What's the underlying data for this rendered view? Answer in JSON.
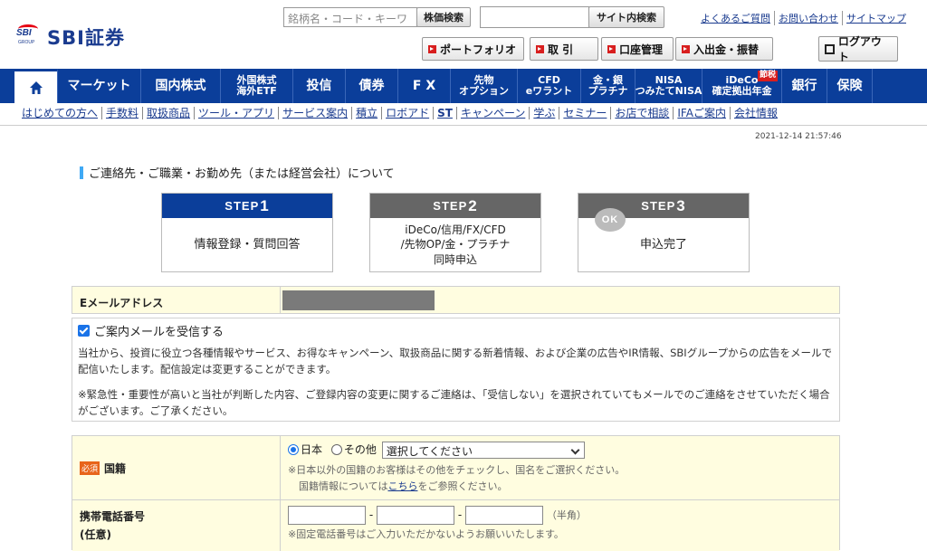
{
  "header": {
    "logo_mark": "SBI",
    "logo_group": "GROUP",
    "logo_text": "SBI証券",
    "search_placeholder": "銘柄名・コード・キーワ",
    "search_button": "株価検索",
    "site_search_button": "サイト内検索",
    "top_links": [
      "よくあるご質問",
      "お問い合わせ",
      "サイトマップ"
    ],
    "user_buttons": [
      "ポートフォリオ",
      "取 引",
      "口座管理",
      "入出金・振替"
    ],
    "logout": "ログアウト"
  },
  "nav": {
    "items": [
      {
        "label": "マーケット"
      },
      {
        "label": "国内株式"
      },
      {
        "label": "外国株式\n海外ETF"
      },
      {
        "label": "投信"
      },
      {
        "label": "債券"
      },
      {
        "label": "F X"
      },
      {
        "label": "先物\nオプション"
      },
      {
        "label": "CFD\neワラント"
      },
      {
        "label": "金・銀\nプラチナ"
      },
      {
        "label": "NISA\nつみたてNISA"
      },
      {
        "label": "iDeCo\n確定拠出年金",
        "badge": "節税"
      },
      {
        "label": "銀行"
      },
      {
        "label": "保険"
      }
    ],
    "sub_items": [
      "はじめての方へ",
      "手数料",
      "取扱商品",
      "ツール・アプリ",
      "サービス案内",
      "積立",
      "ロボアド",
      "ST",
      "キャンペーン",
      "学ぶ",
      "セミナー",
      "お店で相談",
      "IFAご案内",
      "会社情報"
    ]
  },
  "timestamp": "2021-12-14 21:57:46",
  "section_title": "ご連絡先・ご職業・お勤め先（または経営会社）について",
  "steps": [
    {
      "label": "STEP",
      "num": "1",
      "body": "情報登録・質問回答",
      "color": "#0b3e9a"
    },
    {
      "label": "STEP",
      "num": "2",
      "body": "iDeCo/信用/FX/CFD\n/先物OP/金・プラチナ\n同時申込",
      "color": "#666666"
    },
    {
      "label": "STEP",
      "num": "3",
      "body": "申込完了",
      "color": "#666666",
      "ok": "OK"
    }
  ],
  "email": {
    "label": "Eメールアドレス"
  },
  "mail_option": {
    "checkbox_label": "ご案内メールを受信する",
    "checked": true,
    "paragraph1": "当社から、投資に役立つ各種情報やサービス、お得なキャンペーン、取扱商品に関する新着情報、および企業の広告やIR情報、SBIグループからの広告をメールで配信いたします。配信設定は変更することができます。",
    "paragraph2": "※緊急性・重要性が高いと当社が判断した内容、ご登録内容の変更に関するご連絡は、「受信しない」を選択されていてもメールでのご連絡をさせていただく場合がございます。ご了承ください。"
  },
  "nationality": {
    "required_badge": "必須",
    "label": "国籍",
    "option_japan": "日本",
    "option_other": "その他",
    "selected": "日本",
    "select_value": "選択してください",
    "note1": "※日本以外の国籍のお客様はその他をチェックし、国名をご選択ください。",
    "note2_prefix": "国籍情報については",
    "note2_link": "こちら",
    "note2_suffix": "をご参照ください。"
  },
  "mobile": {
    "label": "携帯電話番号",
    "sublabel": "(任意)",
    "separator": "-",
    "halfwidth": "（半角）",
    "note": "※固定電話番号はご入力いただかないようお願いいたします。"
  }
}
